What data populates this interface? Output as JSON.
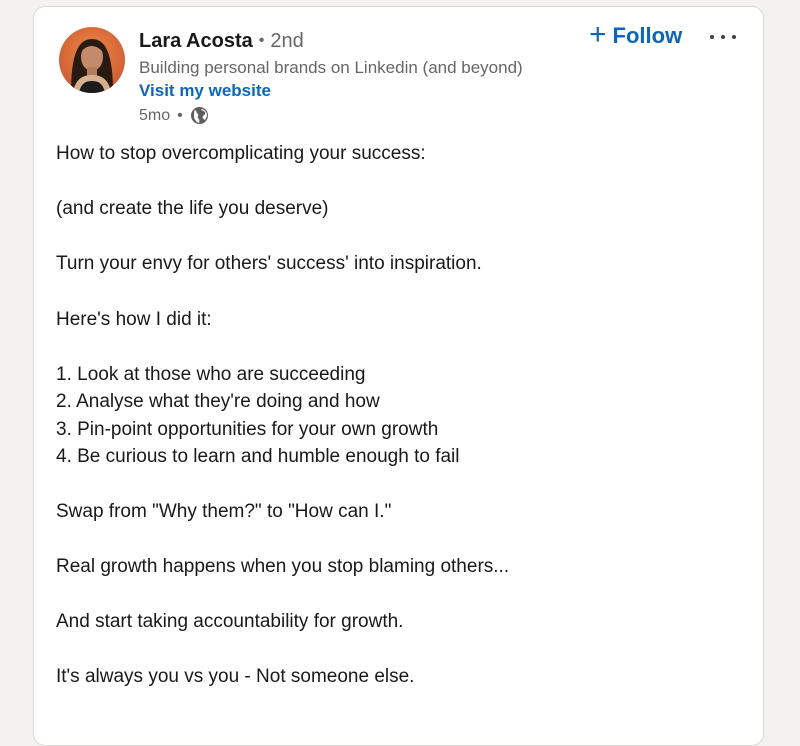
{
  "post": {
    "author": {
      "name": "Lara Acosta",
      "degree_separator": "•",
      "degree": "2nd",
      "headline": "Building personal brands on Linkedin (and beyond)",
      "website_link": "Visit my website",
      "timestamp": "5mo",
      "meta_separator": "•",
      "visibility_icon": "globe-icon"
    },
    "actions": {
      "follow_icon": "+",
      "follow_label": "Follow",
      "more_icon": "ellipsis-icon"
    },
    "body_lines": [
      "How to stop overcomplicating your success:",
      "(and create the life you deserve)",
      "Turn your envy for others' success' into inspiration.",
      "Here's how I did it:",
      "1. Look at those who are succeeding",
      "2. Analyse what they're doing and how",
      "3. Pin-point opportunities for your own growth",
      "4. Be curious to learn and humble enough to fail",
      "Swap from \"Why them?\" to \"How can I.\"",
      "Real growth happens when you stop blaming others...",
      "And start taking accountability for growth.",
      "It's always you vs you - Not someone else."
    ]
  },
  "colors": {
    "link_blue": "#0a66c2",
    "primary_text": "#191919",
    "secondary_text": "#666666",
    "card_bg": "#ffffff",
    "page_bg": "#f4f2ee"
  }
}
